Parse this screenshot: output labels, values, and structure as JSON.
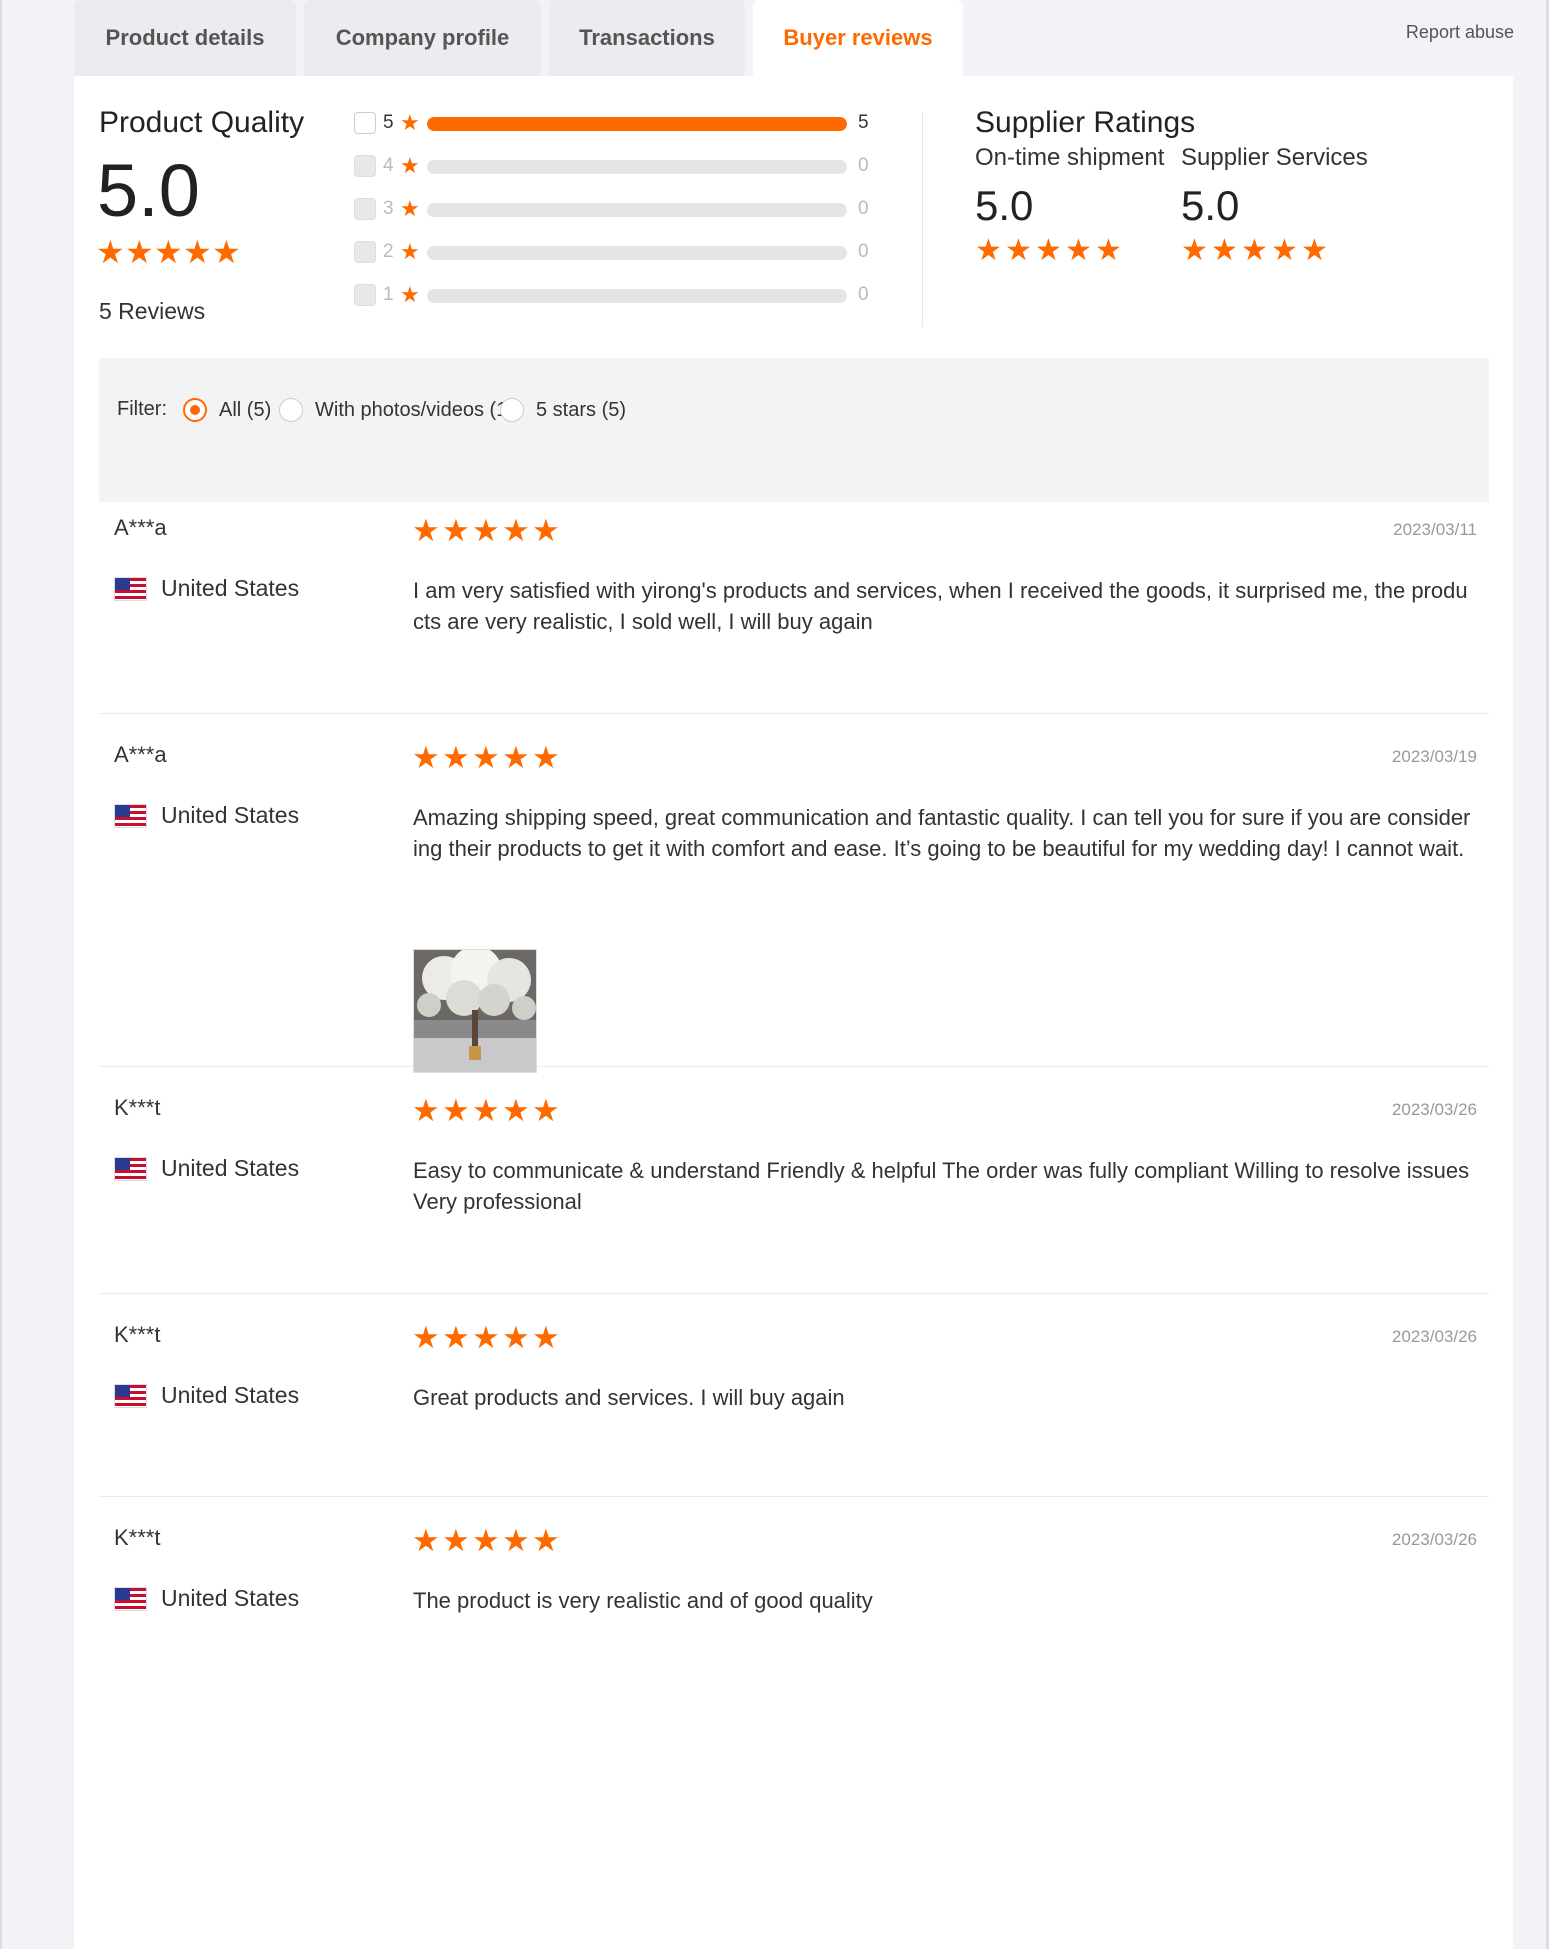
{
  "tabs": [
    {
      "label": "Product details",
      "active": false
    },
    {
      "label": "Company profile",
      "active": false
    },
    {
      "label": "Transactions",
      "active": false
    },
    {
      "label": "Buyer reviews",
      "active": true
    }
  ],
  "report_abuse": "Report abuse",
  "product_quality": {
    "title": "Product Quality",
    "score": "5.0",
    "stars": 5,
    "reviews_label": "5 Reviews",
    "distribution": [
      {
        "level": "5",
        "count": "5",
        "fraction": 1.0
      },
      {
        "level": "4",
        "count": "0",
        "fraction": 0
      },
      {
        "level": "3",
        "count": "0",
        "fraction": 0
      },
      {
        "level": "2",
        "count": "0",
        "fraction": 0
      },
      {
        "level": "1",
        "count": "0",
        "fraction": 0
      }
    ]
  },
  "supplier_ratings": {
    "title": "Supplier Ratings",
    "ontime": {
      "label": "On-time shipment",
      "score": "5.0",
      "stars": 5
    },
    "services": {
      "label": "Supplier Services",
      "score": "5.0",
      "stars": 5
    }
  },
  "filter": {
    "label": "Filter:",
    "options": [
      {
        "label": "All (5)",
        "selected": true
      },
      {
        "label": "With photos/videos (1)",
        "selected": false
      },
      {
        "label": "5 stars (5)",
        "selected": false
      }
    ]
  },
  "reviews": [
    {
      "name": "A***a",
      "country": "United States",
      "date": "2023/03/11",
      "stars": 5,
      "text": "I am very satisfied with yirong's products and services, when I received the goods, it surprised me, the products are very realistic, I sold well, I will buy again"
    },
    {
      "name": "A***a",
      "country": "United States",
      "date": "2023/03/19",
      "stars": 5,
      "text": "Amazing shipping speed, great communication and fantastic quality. I can tell you for sure if you are considering their products to get it with comfort and ease. It’s going to be beautiful for my wedding day! I cannot wait.",
      "has_photo": true
    },
    {
      "name": "K***t",
      "country": "United States",
      "date": "2023/03/26",
      "stars": 5,
      "text": "Easy to communicate & understand Friendly & helpful The order was fully compliant Willing to resolve issues Very professional"
    },
    {
      "name": "K***t",
      "country": "United States",
      "date": "2023/03/26",
      "stars": 5,
      "text": "Great products and services. I will buy again"
    },
    {
      "name": "K***t",
      "country": "United States",
      "date": "2023/03/26",
      "stars": 5,
      "text": "The product is very realistic and of good quality"
    }
  ],
  "colors": {
    "accent": "#ff6a00",
    "bar_empty": "#e5e5e5",
    "filter_bg": "#f3f3f3"
  }
}
